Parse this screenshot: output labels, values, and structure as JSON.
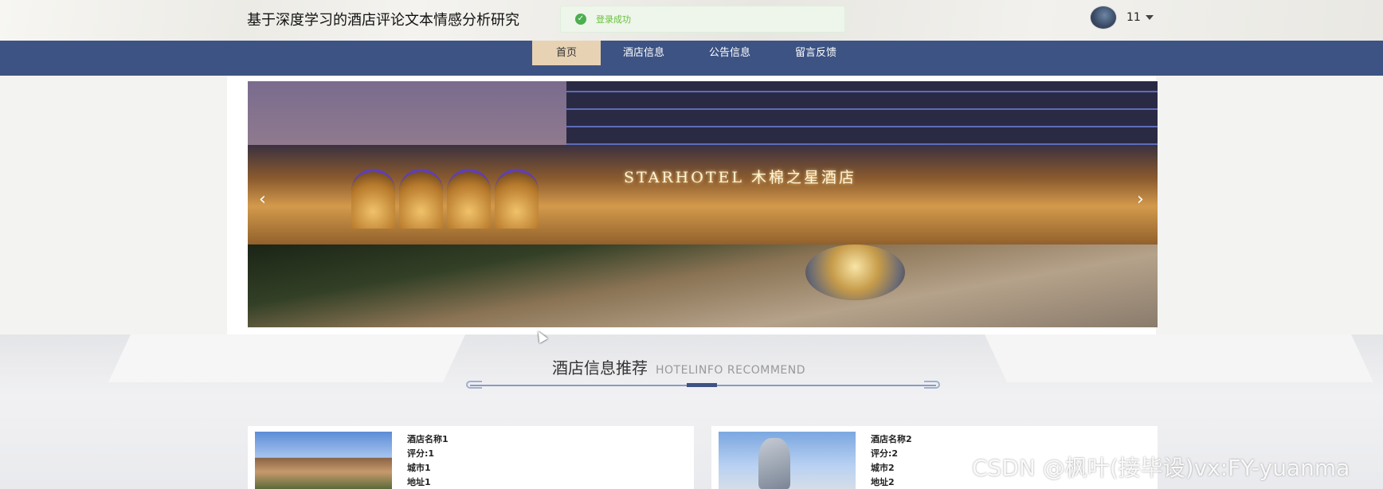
{
  "header": {
    "site_title": "基于深度学习的酒店评论文本情感分析研究",
    "toast_text": "登录成功",
    "user_name": "11"
  },
  "nav": {
    "items": [
      {
        "label": "首页",
        "active": true
      },
      {
        "label": "酒店信息",
        "active": false
      },
      {
        "label": "公告信息",
        "active": false
      },
      {
        "label": "留言反馈",
        "active": false
      }
    ]
  },
  "banner": {
    "sign_text": "STARHOTEL 木棉之星酒店",
    "prev_arrow": "‹",
    "next_arrow": "›"
  },
  "section": {
    "title": "酒店信息推荐",
    "subtitle": "HOTELINFO RECOMMEND"
  },
  "hotels": [
    {
      "name": "酒店名称1",
      "score": "评分:1",
      "city": "城市1",
      "address": "地址1"
    },
    {
      "name": "酒店名称2",
      "score": "评分:2",
      "city": "城市2",
      "address": "地址2"
    }
  ],
  "watermark": "CSDN @枫叶(接毕设)vx:FY-yuanma",
  "colors": {
    "nav_bg": "#3d5383",
    "nav_active_bg": "#e8d2b4",
    "toast_text": "#67c23a"
  }
}
